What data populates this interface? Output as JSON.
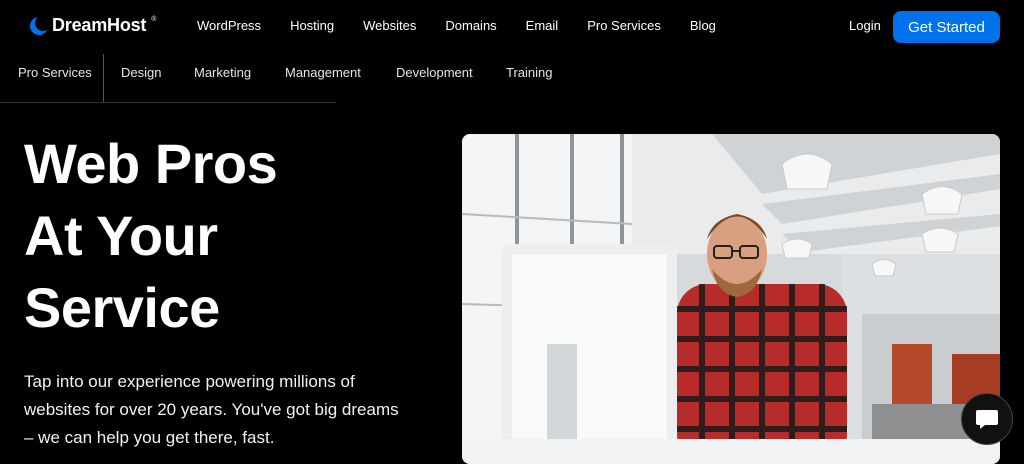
{
  "brand": {
    "name": "DreamHost",
    "tm": "®",
    "color": "#0073ec"
  },
  "topnav": {
    "items": [
      "WordPress",
      "Hosting",
      "Websites",
      "Domains",
      "Email",
      "Pro Services",
      "Blog"
    ],
    "login": "Login",
    "cta": "Get Started"
  },
  "subnav": {
    "items": [
      "Pro Services",
      "Design",
      "Marketing",
      "Management",
      "Development",
      "Training"
    ]
  },
  "hero": {
    "title_lines": [
      "Web Pros",
      "At Your",
      "Service"
    ],
    "description_lines": [
      "Tap into our experience powering millions of",
      "websites for over 20 years. You've got big dreams",
      "– we can help you get there, fast."
    ]
  },
  "icons": {
    "chat": "chat-bubble-icon",
    "logo": "dreamhost-moon-icon"
  }
}
